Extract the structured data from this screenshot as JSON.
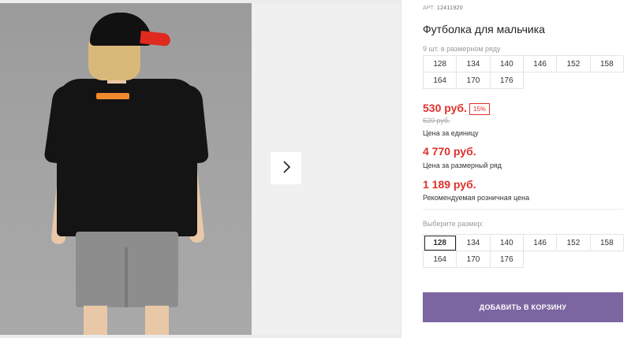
{
  "product": {
    "article_label": "АРТ.",
    "article_number": "12411920",
    "title": "Футболка для мальчика"
  },
  "size_row": {
    "note": "9 шт. в размерном ряду",
    "sizes": [
      "128",
      "134",
      "140",
      "146",
      "152",
      "158",
      "164",
      "170",
      "176"
    ]
  },
  "prices": {
    "unit_price": "530 руб.",
    "discount_badge": "15%",
    "old_price": "620 руб.",
    "unit_price_note": "Цена за единицу",
    "set_price": "4 770 руб.",
    "set_price_note": "Цена за размерный ряд",
    "retail_price": "1 189 руб.",
    "retail_price_note": "Рекомендуемая розничная цена"
  },
  "size_select": {
    "label": "Выберите размер:",
    "selected": "128",
    "sizes": [
      "128",
      "134",
      "140",
      "146",
      "152",
      "158",
      "164",
      "170",
      "176"
    ]
  },
  "actions": {
    "add_to_cart": "ДОБАВИТЬ В КОРЗИНУ"
  },
  "gallery": {
    "next_icon": "chevron-right-icon",
    "print_text": "_____ _______"
  },
  "colors": {
    "accent_price": "#e0302c",
    "cart_button": "#7b66a1"
  }
}
